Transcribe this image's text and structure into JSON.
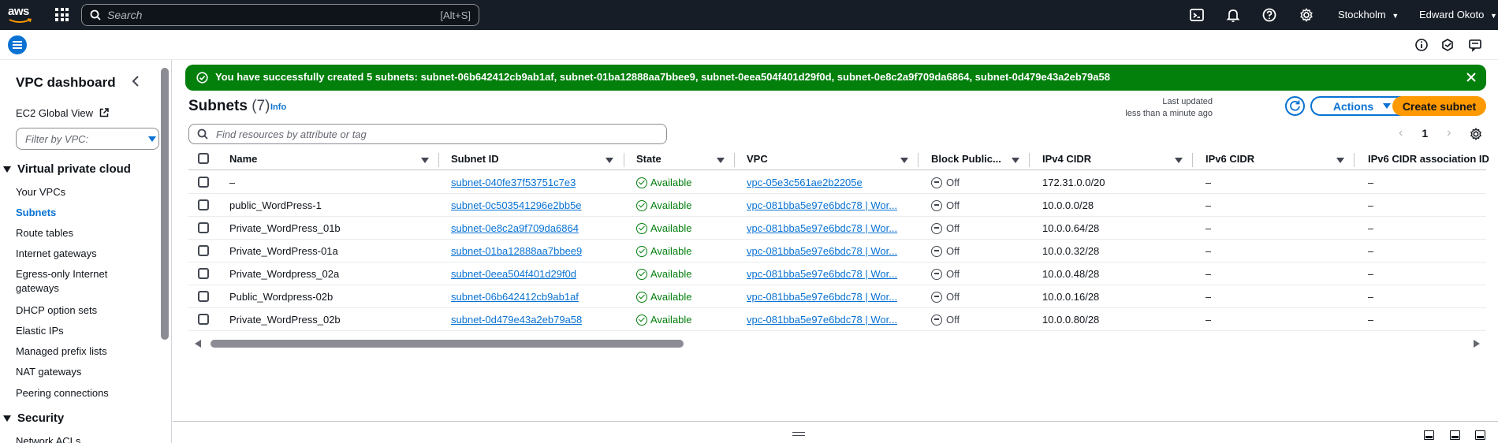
{
  "topnav": {
    "logo": "aws",
    "search_placeholder": "Search",
    "search_shortcut": "[Alt+S]",
    "region": "Stockholm",
    "user": "Edward Okoto"
  },
  "sidebar": {
    "title": "VPC dashboard",
    "global_view": "EC2 Global View",
    "filter_placeholder": "Filter by VPC:",
    "section_vpc": "Virtual private cloud",
    "items": [
      {
        "label": "Your VPCs"
      },
      {
        "label": "Subnets"
      },
      {
        "label": "Route tables"
      },
      {
        "label": "Internet gateways"
      },
      {
        "label": "Egress-only Internet"
      },
      {
        "label": "gateways"
      },
      {
        "label": "DHCP option sets"
      },
      {
        "label": "Elastic IPs"
      },
      {
        "label": "Managed prefix lists"
      },
      {
        "label": "NAT gateways"
      },
      {
        "label": "Peering connections"
      }
    ],
    "section_security": "Security",
    "security_items": [
      {
        "label": "Network ACLs"
      }
    ]
  },
  "flash": {
    "message": "You have successfully created 5 subnets: subnet-06b642412cb9ab1af, subnet-01ba12888aa7bbee9, subnet-0eea504f401d29f0d, subnet-0e8c2a9f709da6864, subnet-0d479e43a2eb79a58"
  },
  "header": {
    "title": "Subnets",
    "count": "(7)",
    "info": "Info",
    "last_updated_1": "Last updated",
    "last_updated_2": "less than a minute ago",
    "actions": "Actions",
    "create": "Create subnet",
    "search_placeholder": "Find resources by attribute or tag",
    "page": "1"
  },
  "table": {
    "columns": [
      "Name",
      "Subnet ID",
      "State",
      "VPC",
      "Block Public...",
      "IPv4 CIDR",
      "IPv6 CIDR",
      "IPv6 CIDR association ID"
    ],
    "rows": [
      {
        "name": "–",
        "subnet_id": "subnet-040fe37f53751c7e3",
        "state": "Available",
        "vpc": "vpc-05e3c561ae2b2205e",
        "block": "Off",
        "ipv4": "172.31.0.0/20",
        "ipv6": "–",
        "ipv6_assoc": "–"
      },
      {
        "name": "public_WordPress-1",
        "subnet_id": "subnet-0c503541296e2bb5e",
        "state": "Available",
        "vpc": "vpc-081bba5e97e6bdc78 | Wor...",
        "block": "Off",
        "ipv4": "10.0.0.0/28",
        "ipv6": "–",
        "ipv6_assoc": "–"
      },
      {
        "name": "Private_WordPress_01b",
        "subnet_id": "subnet-0e8c2a9f709da6864",
        "state": "Available",
        "vpc": "vpc-081bba5e97e6bdc78 | Wor...",
        "block": "Off",
        "ipv4": "10.0.0.64/28",
        "ipv6": "–",
        "ipv6_assoc": "–"
      },
      {
        "name": "Private_WordPress-01a",
        "subnet_id": "subnet-01ba12888aa7bbee9",
        "state": "Available",
        "vpc": "vpc-081bba5e97e6bdc78 | Wor...",
        "block": "Off",
        "ipv4": "10.0.0.32/28",
        "ipv6": "–",
        "ipv6_assoc": "–"
      },
      {
        "name": "Private_Wordpress_02a",
        "subnet_id": "subnet-0eea504f401d29f0d",
        "state": "Available",
        "vpc": "vpc-081bba5e97e6bdc78 | Wor...",
        "block": "Off",
        "ipv4": "10.0.0.48/28",
        "ipv6": "–",
        "ipv6_assoc": "–"
      },
      {
        "name": "Public_Wordpress-02b",
        "subnet_id": "subnet-06b642412cb9ab1af",
        "state": "Available",
        "vpc": "vpc-081bba5e97e6bdc78 | Wor...",
        "block": "Off",
        "ipv4": "10.0.0.16/28",
        "ipv6": "–",
        "ipv6_assoc": "–"
      },
      {
        "name": "Private_WordPress_02b",
        "subnet_id": "subnet-0d479e43a2eb79a58",
        "state": "Available",
        "vpc": "vpc-081bba5e97e6bdc78 | Wor...",
        "block": "Off",
        "ipv4": "10.0.0.80/28",
        "ipv6": "–",
        "ipv6_assoc": "–"
      }
    ]
  },
  "colors": {
    "nav_bg": "#161d26",
    "accent": "#0972d3",
    "success": "#037f0c",
    "primary_button": "#ff9900"
  }
}
